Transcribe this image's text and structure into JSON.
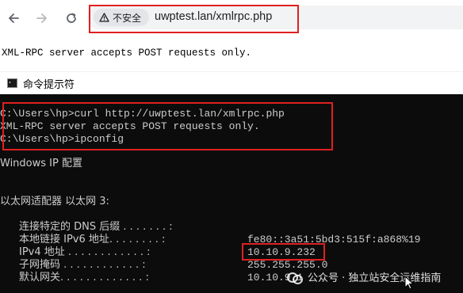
{
  "browser": {
    "security_label": "不安全",
    "url": "uwptest.lan/xmlrpc.php",
    "icons": [
      "back-arrow-icon",
      "forward-arrow-icon",
      "reload-icon",
      "warning-triangle-icon"
    ]
  },
  "page": {
    "message": "XML-RPC server accepts POST requests only."
  },
  "cmd": {
    "title": "命令提示符",
    "line1": "C:\\Users\\hp>curl http://uwptest.lan/xmlrpc.php",
    "line2": "XML-RPC server accepts POST requests only.",
    "line3": "C:\\Users\\hp>ipconfig",
    "line4": "Windows IP 配置",
    "line5": "以太网适配器 以太网 3:",
    "rows": [
      {
        "label": "连接特定的 DNS 后缀 . . . . . . . :",
        "value": ""
      },
      {
        "label": "本地链接 IPv6 地址. . . . . . . . :",
        "value": "fe80::3a51:5bd3:515f:a868%19"
      },
      {
        "label": "IPv4 地址 . . . . . . . . . . . . :",
        "value": "10.10.9.232"
      },
      {
        "label": "子网掩码 . . . . . . . . . . . . :",
        "value": "255.255.255.0"
      },
      {
        "label": "默认网关. . . . . . . . . . . . . :",
        "value": "10.10.9.1"
      }
    ]
  },
  "watermark": "公众号 · 独立站安全运维指南",
  "colors": {
    "highlight": "#e02020",
    "console_bg": "#0c0c0c",
    "console_text": "#cccccc"
  }
}
